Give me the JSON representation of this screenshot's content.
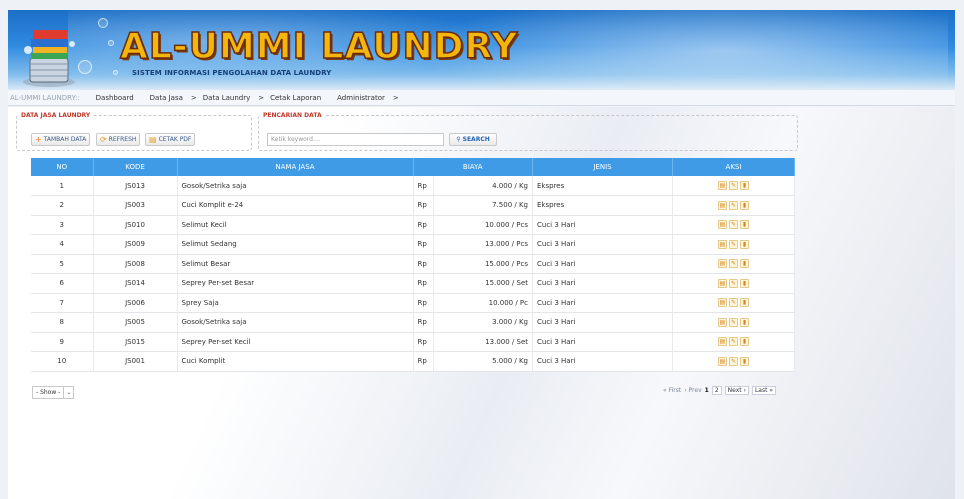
{
  "header": {
    "title": "AL-UMMI LAUNDRY",
    "subtitle": "SISTEM INFORMASI PENGOLAHAN DATA LAUNDRY"
  },
  "nav": {
    "breadcrumb": "AL-UMMI LAUNDRY::",
    "items": [
      {
        "label": "Dashboard",
        "arrow": ""
      },
      {
        "label": "Data Jasa",
        "arrow": ">"
      },
      {
        "label": "Data Laundry",
        "arrow": ">"
      },
      {
        "label": "Cetak Laporan",
        "arrow": ""
      },
      {
        "label": "Administrator",
        "arrow": ">"
      }
    ]
  },
  "panel": {
    "legend": "DATA JASA LAUNDRY",
    "add_label": "TAMBAH DATA",
    "refresh_label": "REFRESH",
    "pdf_label": "CETAK PDF"
  },
  "search": {
    "legend": "PENCARIAN DATA",
    "placeholder": "Ketik keyword....",
    "button_label": "SEARCH"
  },
  "table": {
    "headers": [
      "NO",
      "KODE",
      "NAMA JASA",
      "BIAYA",
      "JENIS",
      "AKSI"
    ],
    "rows": [
      {
        "no": "1",
        "kode": "JS013",
        "nama": "Gosok/Setrika saja",
        "rp": "Rp",
        "biaya": "4.000 / Kg",
        "jenis": "Ekspres"
      },
      {
        "no": "2",
        "kode": "JS003",
        "nama": "Cuci Komplit e-24",
        "rp": "Rp",
        "biaya": "7.500 / Kg",
        "jenis": "Ekspres"
      },
      {
        "no": "3",
        "kode": "JS010",
        "nama": "Selimut Kecil",
        "rp": "Rp",
        "biaya": "10.000 / Pcs",
        "jenis": "Cuci 3 Hari"
      },
      {
        "no": "4",
        "kode": "JS009",
        "nama": "Selimut Sedang",
        "rp": "Rp",
        "biaya": "13.000 / Pcs",
        "jenis": "Cuci 3 Hari"
      },
      {
        "no": "5",
        "kode": "JS008",
        "nama": "Selimut Besar",
        "rp": "Rp",
        "biaya": "15.000 / Pcs",
        "jenis": "Cuci 3 Hari"
      },
      {
        "no": "6",
        "kode": "JS014",
        "nama": "Seprey Per-set Besar",
        "rp": "Rp",
        "biaya": "15.000 / Set",
        "jenis": "Cuci 3 Hari"
      },
      {
        "no": "7",
        "kode": "JS006",
        "nama": "Sprey Saja",
        "rp": "Rp",
        "biaya": "10.000 / Pc",
        "jenis": "Cuci 3 Hari"
      },
      {
        "no": "8",
        "kode": "JS005",
        "nama": "Gosok/Setrika saja",
        "rp": "Rp",
        "biaya": "3.000 / Kg",
        "jenis": "Cuci 3 Hari"
      },
      {
        "no": "9",
        "kode": "JS015",
        "nama": "Seprey Per-set Kecil",
        "rp": "Rp",
        "biaya": "13.000 / Set",
        "jenis": "Cuci 3 Hari"
      },
      {
        "no": "10",
        "kode": "JS001",
        "nama": "Cuci Komplit",
        "rp": "Rp",
        "biaya": "5.000 / Kg",
        "jenis": "Cuci 3 Hari"
      }
    ],
    "action_icons": [
      "print-icon",
      "edit-icon",
      "delete-icon"
    ]
  },
  "footer": {
    "show_label": "- Show -",
    "pager": {
      "first": "« First",
      "prev": "‹ Prev",
      "pages": [
        "1",
        "2"
      ],
      "current": "1",
      "next": "Next ›",
      "last": "Last »"
    }
  },
  "colors": {
    "header_blue": "#2f8ae0",
    "title_gold": "#f3b60c",
    "table_header": "#3f9be6",
    "legend_red": "#c0392b"
  }
}
